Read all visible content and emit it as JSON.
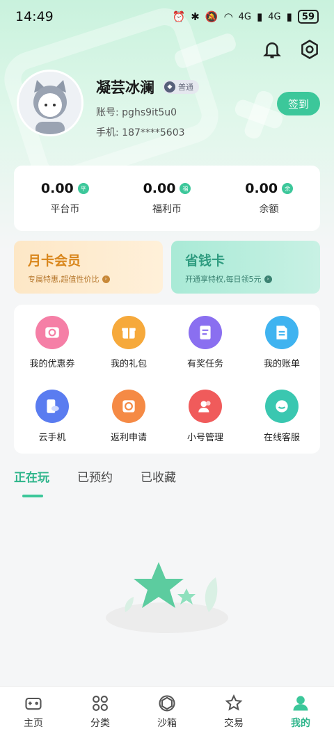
{
  "status_bar": {
    "time": "14:49",
    "signal_1": "4G",
    "signal_2": "4G",
    "battery": "59"
  },
  "profile": {
    "nickname": "凝芸冰澜",
    "level": "普通",
    "account_label": "账号:",
    "account": "pghs9it5u0",
    "phone_label": "手机:",
    "phone": "187****5603",
    "signin_label": "签到"
  },
  "balances": [
    {
      "value": "0.00",
      "badge": "平",
      "label": "平台币"
    },
    {
      "value": "0.00",
      "badge": "福",
      "label": "福利币"
    },
    {
      "value": "0.00",
      "badge": "余",
      "label": "余额"
    }
  ],
  "promos": {
    "monthly": {
      "title": "月卡会员",
      "subtitle": "专属特惠,超值性价比"
    },
    "saver": {
      "title": "省钱卡",
      "subtitle": "开通享特权,每日领5元"
    }
  },
  "grid": [
    {
      "label": "我的优惠券",
      "icon": "coupon-icon",
      "color": "#f57fa6"
    },
    {
      "label": "我的礼包",
      "icon": "gift-icon",
      "color": "#f6a93b"
    },
    {
      "label": "有奖任务",
      "icon": "task-icon",
      "color": "#8a6ff0"
    },
    {
      "label": "我的账单",
      "icon": "bill-icon",
      "color": "#3fb3f0"
    },
    {
      "label": "云手机",
      "icon": "cloud-phone-icon",
      "color": "#5a7cf0"
    },
    {
      "label": "返利申请",
      "icon": "rebate-icon",
      "color": "#f58a45"
    },
    {
      "label": "小号管理",
      "icon": "accounts-icon",
      "color": "#f05b5b"
    },
    {
      "label": "在线客服",
      "icon": "support-icon",
      "color": "#3ac7b0"
    }
  ],
  "tabs": [
    "正在玩",
    "已预约",
    "已收藏"
  ],
  "bottom_nav": [
    {
      "label": "主页",
      "icon": "gamepad-icon"
    },
    {
      "label": "分类",
      "icon": "category-icon"
    },
    {
      "label": "沙箱",
      "icon": "sandbox-icon"
    },
    {
      "label": "交易",
      "icon": "trade-icon"
    },
    {
      "label": "我的",
      "icon": "profile-icon"
    }
  ],
  "colors": {
    "accent": "#3cc79a",
    "accent_text": "#2eb58b"
  }
}
